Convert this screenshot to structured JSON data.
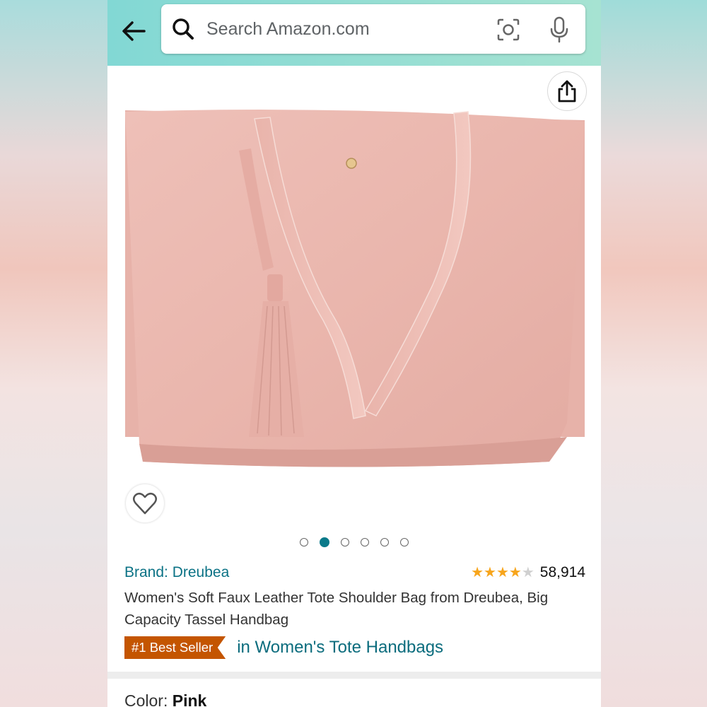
{
  "search": {
    "placeholder": "Search Amazon.com"
  },
  "product": {
    "brand": "Brand: Dreubea",
    "rating_count": "58,914",
    "rating_value": 4,
    "title": "Women's Soft Faux Leather Tote Shoulder Bag from Dreubea, Big Capacity Tassel Handbag",
    "badge": "#1 Best Seller",
    "badge_category": "in Women's Tote Handbags",
    "color_label": "Color:",
    "color_value": "Pink"
  },
  "gallery": {
    "image_count": 6,
    "active_index": 1
  },
  "colors": {
    "star": "#f7a51c",
    "star_empty": "#d0d0d0",
    "badge": "#c45500",
    "link": "#0b7285",
    "bag": "#e9b5ad"
  },
  "icons": [
    "back-arrow-icon",
    "search-icon",
    "camera-icon",
    "microphone-icon",
    "share-icon",
    "heart-icon"
  ]
}
